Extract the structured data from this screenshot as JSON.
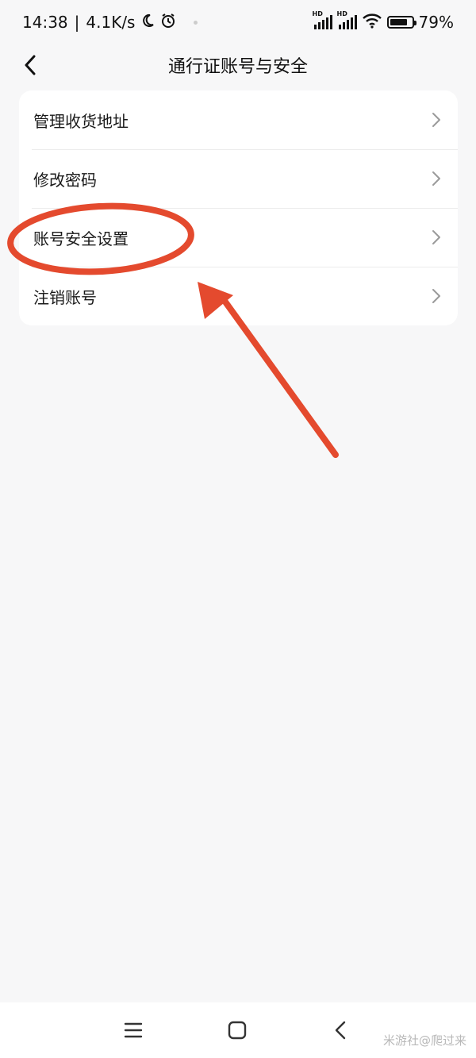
{
  "status_bar": {
    "time": "14:38",
    "separator": "|",
    "network_speed": "4.1K/s",
    "hd_label_1": "HD",
    "hd_label_2": "HD",
    "battery_percent": "79%",
    "battery_level": 0.79
  },
  "header": {
    "title": "通行证账号与安全"
  },
  "settings": {
    "items": [
      {
        "label": "管理收货地址"
      },
      {
        "label": "修改密码"
      },
      {
        "label": "账号安全设置"
      },
      {
        "label": "注销账号"
      }
    ]
  },
  "watermark": "米游社@爬过来",
  "colors": {
    "background": "#f7f7f8",
    "card": "#ffffff",
    "annotation": "#e44a2e",
    "chevron": "#9a9a9a"
  }
}
